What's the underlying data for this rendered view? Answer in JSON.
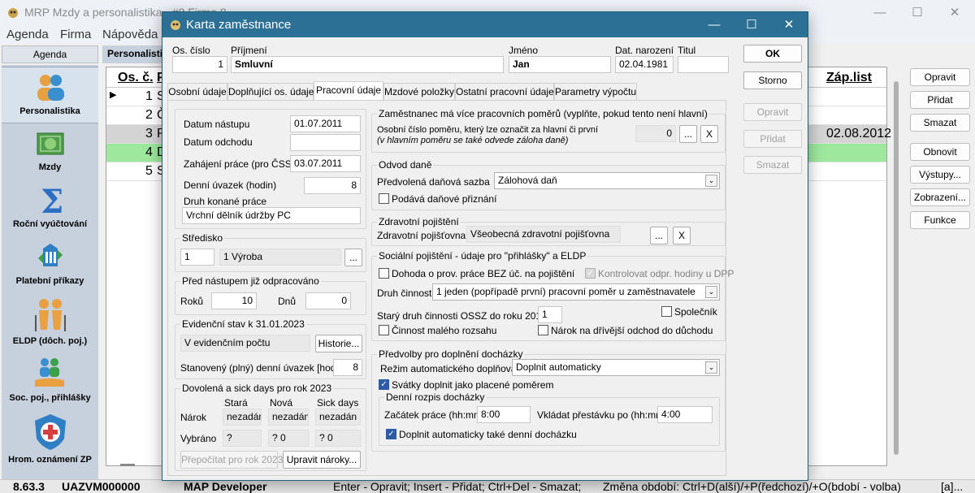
{
  "main": {
    "title": "MRP Mzdy a personalistika - #8 Firma 8",
    "menu": [
      "Agenda",
      "Firma",
      "Nápověda"
    ],
    "agenda_header": "Agenda",
    "sidebar": [
      {
        "label": "Personalistika",
        "icon": "people-icon"
      },
      {
        "label": "Mzdy",
        "icon": "money-icon"
      },
      {
        "label": "Roční vyúčtování",
        "icon": "sigma-icon"
      },
      {
        "label": "Platební příkazy",
        "icon": "bank-icon"
      },
      {
        "label": "ELDP (dôch. poj.)",
        "icon": "elderly-icon"
      },
      {
        "label": "Soc. poj., přihlášky",
        "icon": "hand-people-icon"
      },
      {
        "label": "Hrom. oznámení ZP",
        "icon": "medical-shield-icon"
      }
    ],
    "tab_label": "Personalisti",
    "grid": {
      "col_os": "Os. č.",
      "col_p": "P",
      "col_zap": "Záp.list",
      "rows": [
        {
          "n": "1",
          "p": "S",
          "zap": ""
        },
        {
          "n": "2",
          "p": "Č",
          "zap": ""
        },
        {
          "n": "3",
          "p": "P",
          "zap": "02.08.2012"
        },
        {
          "n": "4",
          "p": "D",
          "zap": ""
        },
        {
          "n": "5",
          "p": "S",
          "zap": ""
        }
      ]
    },
    "right_buttons": [
      "Opravit",
      "Přidat",
      "Smazat",
      "Obnovit",
      "Výstupy...",
      "Zobrazení...",
      "Funkce"
    ],
    "status": {
      "version": "8.63.3",
      "machine": "UAZVM000000",
      "user": "MAP Developer",
      "hint": "Enter - Opravit; Insert - Přidat; Ctrl+Del - Smazat;",
      "period": "Změna období: Ctrl+D(alší)/+P(ředchozí)/+O(bdobí - volba)",
      "lang": "[a]..."
    },
    "colors": {
      "titlebar": "#eef2f7",
      "sidebar": "#c6d1dd",
      "selected_row": "#9ee89e",
      "gray_row": "#d4d4d4"
    }
  },
  "dialog": {
    "title": "Karta zaměstnance",
    "header": {
      "os_cislo_label": "Os. číslo",
      "os_cislo": "1",
      "prijmeni_label": "Příjmení",
      "prijmeni": "Smluvní",
      "jmeno_label": "Jméno",
      "jmeno": "Jan",
      "dat_nar_label": "Dat. narození",
      "dat_nar": "02.04.1981",
      "titul_label": "Titul",
      "titul": ""
    },
    "buttons": {
      "ok": "OK",
      "storno": "Storno",
      "opravit": "Opravit",
      "pridat": "Přidat",
      "smazat": "Smazat"
    },
    "tabs": [
      "Osobní údaje",
      "Doplňující os. údaje",
      "Pracovní údaje",
      "Mzdové položky",
      "Ostatní pracovní údaje",
      "Parametry výpočtu"
    ],
    "left": {
      "datum_nastupu_label": "Datum nástupu",
      "datum_nastupu": "01.07.2011",
      "datum_odchodu_label": "Datum odchodu",
      "datum_odchodu": "",
      "zahajeni_label": "Zahájení práce (pro ČSSZ)",
      "zahajeni": "03.07.2011",
      "uvazek_label": "Denní úvazek (hodin)",
      "uvazek": "8",
      "druh_prace_label": "Druh konané práce",
      "druh_prace": "Vrchní dělník údržby PC",
      "stredisko_label": "Středisko",
      "stredisko_cislo": "1",
      "stredisko_nazev": "1 Výroba",
      "dots": "...",
      "pred_nastupem_label": "Před nástupem již odpracováno",
      "roku_label": "Roků",
      "roku": "10",
      "dnu_label": "Dnů",
      "dnu": "0",
      "evid_label": "Evidenční stav k  31.01.2023",
      "evid_stav": "V evidenčním počtu",
      "historie": "Historie...",
      "stanoveny_label": "Stanovený (plný) denní úvazek [hodin]",
      "stanoveny": "8",
      "dovolena_label": "Dovolená a sick days pro rok 2023",
      "col_stara": "Stará",
      "col_nova": "Nová",
      "col_sick": "Sick days",
      "narok_label": "Nárok",
      "narok_stara": "nezadán",
      "narok_nova": "nezadán",
      "narok_sick": "nezadán",
      "vybrano_label": "Vybráno",
      "vybrano_stara": "?",
      "vybrano_nova": "? 0",
      "vybrano_sick": "? 0",
      "prepocitat": "Přepočítat pro rok 2023",
      "upravit_naroky": "Upravit nároky..."
    },
    "right": {
      "vice_pomeru_label": "Zaměstnanec má více pracovních poměrů (vyplňte, pokud tento není hlavní)",
      "osobni_cislo_label": "Osobní číslo poměru, který lze označit za hlavní či první",
      "osobni_cislo_note": "(v hlavním poměru se také odvede záloha daně)",
      "osobni_cislo": "0",
      "dots": "...",
      "x": "X",
      "odvod_dane_label": "Odvod daně",
      "predvolena_sazba_label": "Předvolená daňová sazba",
      "predvolena_sazba": "Zálohová daň",
      "podava_priznani": "Podává daňové přiznání",
      "zdravotni_label": "Zdravotní pojištění",
      "pojistovna_label": "Zdravotní pojišťovna",
      "pojistovna": "Všeobecná zdravotní pojišťovna",
      "socialni_label": "Sociální pojištění -  údaje pro \"přihlášky\" a ELDP",
      "dohoda": "Dohoda o prov. práce BEZ úč. na pojištění",
      "kontrolovat": "Kontrolovat odpr. hodiny u DPP",
      "druh_cinnosti_label": "Druh činnosti",
      "druh_cinnosti": "1   jeden (popřípadě první) pracovní poměr u zaměstnavatele",
      "stary_druh_label": "Starý druh činnosti OSSZ do roku 2011",
      "stary_druh": "1",
      "spolecnik": "Společník",
      "cinnost_maleho": "Činnost malého rozsahu",
      "narok_odchod": "Nárok na dřívější odchod do důchodu",
      "predvolby_label": "Předvolby pro doplnění docházky",
      "rezim_label": "Režim automatického doplňování",
      "rezim": "Doplnit automaticky",
      "svatky": "Svátky doplnit jako placené poměrem",
      "denni_rozpis_label": "Denní rozpis docházky",
      "zacatek_label": "Začátek práce (hh:mm)",
      "zacatek": "8:00",
      "prestavka_label": "Vkládat přestávku po (hh:mm)",
      "prestavka": "4:00",
      "doplnit_denni": "Doplnit automaticky také denní docházku"
    }
  }
}
